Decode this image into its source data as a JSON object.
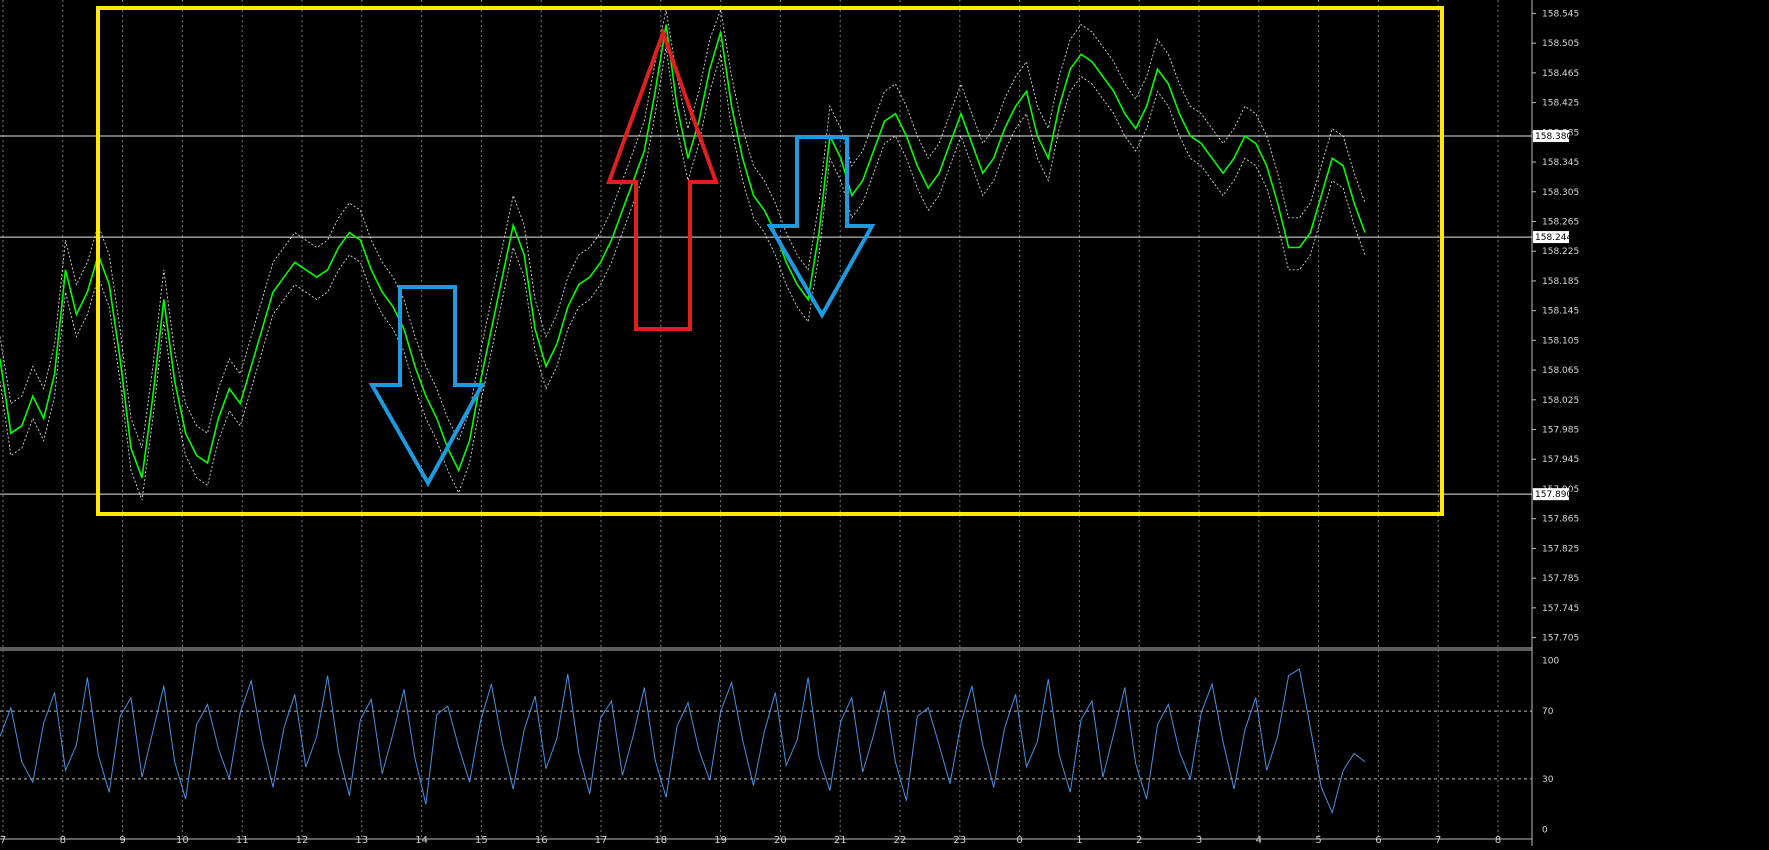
{
  "chart_data": {
    "type": "line",
    "price_panel": {
      "y_tick_labels": [
        "158.545",
        "158.505",
        "158.465",
        "158.425",
        "158.385",
        "158.345",
        "158.305",
        "158.265",
        "158.225",
        "158.185",
        "158.145",
        "158.105",
        "158.065",
        "158.025",
        "157.985",
        "157.945",
        "157.905",
        "157.865",
        "157.825",
        "157.785",
        "157.745",
        "157.705"
      ],
      "y_tick_values": [
        158.545,
        158.505,
        158.465,
        158.425,
        158.385,
        158.345,
        158.305,
        158.265,
        158.225,
        158.185,
        158.145,
        158.105,
        158.065,
        158.025,
        157.985,
        157.945,
        157.905,
        157.865,
        157.825,
        157.785,
        157.745,
        157.705
      ],
      "ylim": [
        157.695,
        158.555
      ],
      "horizontal_levels": [
        {
          "label": "158.380",
          "value": 158.38
        },
        {
          "label": "158.244",
          "value": 158.244
        },
        {
          "label": "157.890",
          "value": 157.898
        }
      ],
      "series": [
        {
          "role": "price",
          "color": "#00ff00",
          "values": [
            158.08,
            157.98,
            157.99,
            158.03,
            158.0,
            158.06,
            158.2,
            158.14,
            158.17,
            158.22,
            158.18,
            158.08,
            157.96,
            157.92,
            158.03,
            158.16,
            158.05,
            157.98,
            157.95,
            157.94,
            158.0,
            158.04,
            158.02,
            158.07,
            158.12,
            158.17,
            158.19,
            158.21,
            158.2,
            158.19,
            158.2,
            158.23,
            158.25,
            158.24,
            158.2,
            158.17,
            158.15,
            158.12,
            158.07,
            158.03,
            158.0,
            157.96,
            157.93,
            157.97,
            158.05,
            158.12,
            158.19,
            158.26,
            158.22,
            158.12,
            158.07,
            158.1,
            158.15,
            158.18,
            158.19,
            158.21,
            158.24,
            158.28,
            158.32,
            158.36,
            158.44,
            158.53,
            158.42,
            158.35,
            158.4,
            158.47,
            158.52,
            158.42,
            158.35,
            158.3,
            158.28,
            158.25,
            158.21,
            158.18,
            158.16,
            158.25,
            158.38,
            158.35,
            158.3,
            158.32,
            158.36,
            158.4,
            158.41,
            158.38,
            158.34,
            158.31,
            158.33,
            158.37,
            158.41,
            158.37,
            158.33,
            158.35,
            158.39,
            158.42,
            158.44,
            158.38,
            158.35,
            158.42,
            158.47,
            158.49,
            158.48,
            158.46,
            158.44,
            158.41,
            158.39,
            158.42,
            158.47,
            158.45,
            158.41,
            158.38,
            158.37,
            158.35,
            158.33,
            158.35,
            158.38,
            158.37,
            158.34,
            158.29,
            158.23,
            158.23,
            158.25,
            158.3,
            158.35,
            158.34,
            158.29,
            158.25
          ]
        },
        {
          "role": "band-upper",
          "color": "#ffffff",
          "values": [
            158.11,
            158.02,
            158.03,
            158.07,
            158.04,
            158.1,
            158.24,
            158.18,
            158.21,
            158.26,
            158.22,
            158.12,
            158.0,
            157.96,
            158.07,
            158.2,
            158.09,
            158.02,
            157.99,
            157.98,
            158.04,
            158.08,
            158.06,
            158.11,
            158.16,
            158.21,
            158.23,
            158.25,
            158.24,
            158.23,
            158.24,
            158.27,
            158.29,
            158.28,
            158.24,
            158.21,
            158.19,
            158.16,
            158.11,
            158.07,
            158.04,
            158.0,
            157.97,
            158.01,
            158.09,
            158.16,
            158.23,
            158.3,
            158.26,
            158.16,
            158.11,
            158.14,
            158.19,
            158.22,
            158.23,
            158.25,
            158.28,
            158.32,
            158.36,
            158.4,
            158.48,
            158.55,
            158.46,
            158.39,
            158.44,
            158.51,
            158.55,
            158.46,
            158.39,
            158.34,
            158.32,
            158.29,
            158.25,
            158.22,
            158.2,
            158.29,
            158.42,
            158.39,
            158.34,
            158.36,
            158.4,
            158.44,
            158.45,
            158.42,
            158.38,
            158.35,
            158.37,
            158.41,
            158.45,
            158.41,
            158.37,
            158.39,
            158.43,
            158.46,
            158.48,
            158.42,
            158.39,
            158.46,
            158.51,
            158.53,
            158.52,
            158.5,
            158.48,
            158.45,
            158.43,
            158.46,
            158.51,
            158.49,
            158.45,
            158.42,
            158.41,
            158.39,
            158.37,
            158.39,
            158.42,
            158.41,
            158.38,
            158.33,
            158.27,
            158.27,
            158.29,
            158.34,
            158.39,
            158.38,
            158.33,
            158.29
          ]
        },
        {
          "role": "band-lower",
          "color": "#ffffff",
          "values": [
            158.05,
            157.95,
            157.96,
            158.0,
            157.97,
            158.03,
            158.17,
            158.11,
            158.14,
            158.19,
            158.15,
            158.05,
            157.93,
            157.89,
            158.0,
            158.13,
            158.02,
            157.95,
            157.92,
            157.91,
            157.97,
            158.01,
            157.99,
            158.04,
            158.09,
            158.14,
            158.16,
            158.18,
            158.17,
            158.16,
            158.17,
            158.2,
            158.22,
            158.21,
            158.17,
            158.14,
            158.12,
            158.09,
            158.04,
            158.0,
            157.97,
            157.93,
            157.9,
            157.94,
            158.02,
            158.09,
            158.16,
            158.23,
            158.19,
            158.09,
            158.04,
            158.07,
            158.12,
            158.15,
            158.16,
            158.18,
            158.21,
            158.25,
            158.29,
            158.33,
            158.41,
            158.5,
            158.39,
            158.32,
            158.37,
            158.44,
            158.49,
            158.39,
            158.32,
            158.27,
            158.25,
            158.22,
            158.18,
            158.15,
            158.13,
            158.22,
            158.35,
            158.32,
            158.27,
            158.29,
            158.33,
            158.37,
            158.38,
            158.35,
            158.31,
            158.28,
            158.3,
            158.34,
            158.38,
            158.34,
            158.3,
            158.32,
            158.36,
            158.39,
            158.41,
            158.35,
            158.32,
            158.39,
            158.44,
            158.46,
            158.45,
            158.43,
            158.41,
            158.38,
            158.36,
            158.39,
            158.44,
            158.42,
            158.38,
            158.35,
            158.34,
            158.32,
            158.3,
            158.32,
            158.35,
            158.34,
            158.31,
            158.26,
            158.2,
            158.2,
            158.22,
            158.27,
            158.32,
            158.31,
            158.26,
            158.22
          ]
        }
      ]
    },
    "oscillator_panel": {
      "y_tick_labels": [
        "100",
        "70",
        "30",
        "0"
      ],
      "y_tick_values": [
        100,
        70,
        30,
        0
      ],
      "ylim": [
        -5,
        105
      ],
      "levels": [
        70,
        30
      ],
      "series": [
        {
          "role": "oscillator",
          "color": "#4a90e2",
          "values": [
            55,
            72,
            40,
            28,
            63,
            81,
            35,
            50,
            90,
            44,
            22,
            67,
            78,
            31,
            58,
            85,
            40,
            18,
            62,
            74,
            48,
            30,
            69,
            88,
            52,
            25,
            60,
            80,
            37,
            55,
            91,
            46,
            20,
            65,
            77,
            33,
            57,
            83,
            42,
            15,
            68,
            73,
            49,
            28,
            64,
            86,
            51,
            24,
            59,
            79,
            36,
            54,
            92,
            45,
            21,
            66,
            76,
            32,
            56,
            84,
            41,
            19,
            61,
            75,
            47,
            29,
            70,
            87,
            53,
            26,
            58,
            81,
            38,
            53,
            90,
            43,
            23,
            64,
            78,
            34,
            56,
            82,
            40,
            17,
            67,
            72,
            50,
            27,
            63,
            85,
            50,
            25,
            60,
            80,
            37,
            52,
            89,
            44,
            22,
            65,
            76,
            31,
            57,
            84,
            39,
            18,
            62,
            74,
            46,
            30,
            69,
            86,
            52,
            24,
            59,
            78,
            35,
            55,
            91,
            95,
            60,
            25,
            10,
            35,
            45,
            40
          ]
        }
      ]
    },
    "x_tick_labels": [
      "7",
      "8",
      "9",
      "10",
      "11",
      "12",
      "13",
      "14",
      "15",
      "16",
      "17",
      "18",
      "19",
      "20",
      "21",
      "22",
      "23",
      "0",
      "1",
      "2",
      "3",
      "4",
      "5",
      "6",
      "7",
      "8"
    ],
    "annotations": [
      {
        "kind": "rectangle",
        "color": "#ffeb00"
      },
      {
        "kind": "arrow-down",
        "color": "#1e9be0"
      },
      {
        "kind": "arrow-up",
        "color": "#e02020"
      },
      {
        "kind": "arrow-down",
        "color": "#1e9be0"
      }
    ],
    "grid": true,
    "background": "#000000"
  }
}
